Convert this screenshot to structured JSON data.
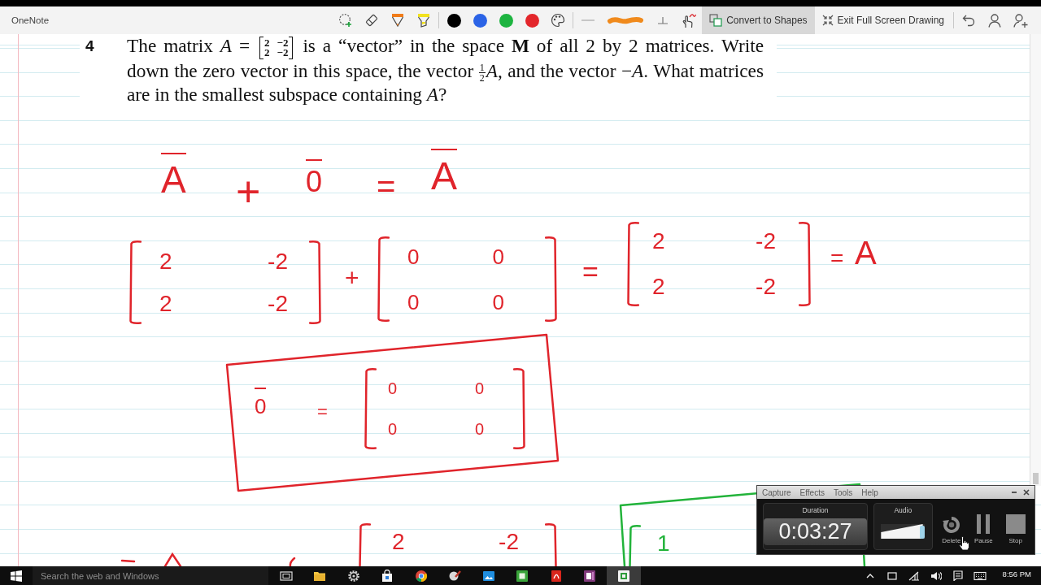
{
  "toolbar": {
    "app_name": "OneNote",
    "groups": [
      [
        {
          "kind": "lasso"
        },
        {
          "kind": "eraser"
        },
        {
          "kind": "pen"
        },
        {
          "kind": "highlighter"
        }
      ],
      [
        {
          "kind": "swatch",
          "color": "#000000"
        },
        {
          "kind": "swatch",
          "color": "#2b63e6"
        },
        {
          "kind": "swatch",
          "color": "#1db440"
        },
        {
          "kind": "swatch",
          "color": "#e3262b"
        },
        {
          "kind": "palette"
        }
      ],
      [
        {
          "kind": "thin"
        },
        {
          "kind": "stroke"
        },
        {
          "kind": "perpendicular"
        }
      ],
      [
        {
          "kind": "touch"
        },
        {
          "kind": "convert",
          "label": "Convert to Shapes",
          "selected": true
        },
        {
          "kind": "exit",
          "label": "Exit Full Screen Drawing",
          "selected": false
        }
      ],
      [
        {
          "kind": "undo"
        },
        {
          "kind": "person"
        },
        {
          "kind": "addperson"
        }
      ]
    ]
  },
  "problem": {
    "number": "4",
    "segments": [
      {
        "kind": "text",
        "text": "The matrix *A* = "
      },
      {
        "kind": "matrix",
        "rows": [
          [
            "2",
            "−2"
          ],
          [
            "2",
            "−2"
          ]
        ]
      },
      {
        "kind": "text",
        "text": " is a “vector” in the space **M** of all 2 by 2 matrices. Write down the zero vector in this space, the vector "
      },
      {
        "kind": "fraction",
        "numerator": "1",
        "denominator": "2"
      },
      {
        "kind": "text",
        "text": "*A*, and the vector −*A*. What matrices are in the smallest subspace containing *A*?"
      }
    ]
  },
  "ink": [
    {
      "color": "#e0242b",
      "boxed": false,
      "items": [
        {
          "kind": "vector",
          "text": "A"
        },
        {
          "kind": "text",
          "text": "+"
        },
        {
          "kind": "vector",
          "text": "0"
        },
        {
          "kind": "text",
          "text": "="
        },
        {
          "kind": "vector",
          "text": "A"
        }
      ]
    },
    {
      "color": "#e0242b",
      "boxed": false,
      "items": [
        {
          "kind": "matrix",
          "rows": [
            [
              "2",
              "-2"
            ],
            [
              "2",
              "-2"
            ]
          ]
        },
        {
          "kind": "text",
          "text": "+"
        },
        {
          "kind": "matrix",
          "rows": [
            [
              "0",
              "0"
            ],
            [
              "0",
              "0"
            ]
          ]
        },
        {
          "kind": "text",
          "text": "="
        },
        {
          "kind": "matrix",
          "rows": [
            [
              "2",
              "-2"
            ],
            [
              "2",
              "-2"
            ]
          ]
        },
        {
          "kind": "text",
          "text": "="
        },
        {
          "kind": "text",
          "text": "A"
        }
      ]
    },
    {
      "color": "#e0242b",
      "boxed": true,
      "items": [
        {
          "kind": "vector",
          "text": "0"
        },
        {
          "kind": "text",
          "text": "="
        },
        {
          "kind": "matrix",
          "rows": [
            [
              "0",
              "0"
            ],
            [
              "0",
              "0"
            ]
          ]
        }
      ]
    },
    {
      "color": "#e0242b",
      "boxed": false,
      "items": [
        {
          "kind": "matrix",
          "rows": [
            [
              "2",
              "-2"
            ]
          ]
        }
      ]
    },
    {
      "color": "#22b33a",
      "boxed": true,
      "items": [
        {
          "kind": "matrix",
          "rows": [
            [
              "1"
            ]
          ]
        }
      ]
    }
  ],
  "recorder": {
    "menu": [
      "Capture",
      "Effects",
      "Tools",
      "Help"
    ],
    "duration": {
      "label": "Duration",
      "time": "0:03:27"
    },
    "audio": {
      "label": "Audio",
      "level": 0.95
    },
    "buttons": [
      {
        "kind": "delete",
        "label": "Delete"
      },
      {
        "kind": "pause",
        "label": "Pause"
      },
      {
        "kind": "stop",
        "label": "Stop"
      }
    ]
  },
  "taskbar": {
    "search": {
      "placeholder": "Search the web and Windows"
    },
    "apps": [
      {
        "kind": "taskview",
        "selected": false
      },
      {
        "kind": "folder",
        "selected": false
      },
      {
        "kind": "gear",
        "selected": false
      },
      {
        "kind": "bag",
        "selected": false
      },
      {
        "kind": "browser",
        "selected": false
      },
      {
        "kind": "paint",
        "selected": false
      },
      {
        "kind": "photos",
        "selected": false
      },
      {
        "kind": "recorder",
        "selected": false
      },
      {
        "kind": "reader",
        "selected": false
      },
      {
        "kind": "notes",
        "selected": false
      },
      {
        "kind": "capture",
        "selected": true
      }
    ],
    "tray": [
      {
        "kind": "caret"
      },
      {
        "kind": "tablet"
      },
      {
        "kind": "network"
      },
      {
        "kind": "volume"
      },
      {
        "kind": "message"
      },
      {
        "kind": "keyboard"
      }
    ],
    "clock": "8:56 PM"
  }
}
